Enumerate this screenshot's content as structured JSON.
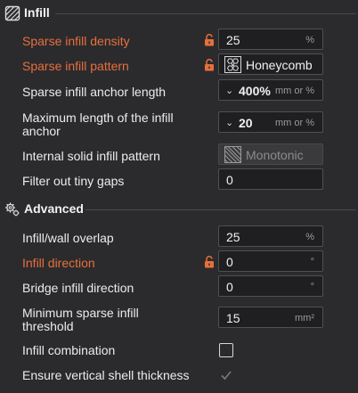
{
  "sections": {
    "infill": {
      "title": "Infill"
    },
    "advanced": {
      "title": "Advanced"
    }
  },
  "infill": {
    "sparse_density": {
      "label": "Sparse infill density",
      "value": "25",
      "unit": "%"
    },
    "sparse_pattern": {
      "label": "Sparse infill pattern",
      "value": "Honeycomb"
    },
    "anchor_length": {
      "label": "Sparse infill anchor length",
      "value": "400%",
      "unit": "mm or %"
    },
    "max_anchor": {
      "label_line1": "Maximum length of the infill",
      "label_line2": "anchor",
      "value": "20",
      "unit": "mm or %"
    },
    "internal_solid": {
      "label": "Internal solid infill pattern",
      "value": "Monotonic"
    },
    "filter_gaps": {
      "label": "Filter out tiny gaps",
      "value": "0"
    }
  },
  "advanced": {
    "overlap": {
      "label": "Infill/wall overlap",
      "value": "25",
      "unit": "%"
    },
    "direction": {
      "label": "Infill direction",
      "value": "0",
      "unit": "°"
    },
    "bridge_direction": {
      "label": "Bridge infill direction",
      "value": "0",
      "unit": "°"
    },
    "min_threshold": {
      "label_line1": "Minimum sparse infill",
      "label_line2": "threshold",
      "value": "15",
      "unit": "mm²"
    },
    "combination": {
      "label": "Infill combination",
      "checked": false
    },
    "vertical_shell": {
      "label": "Ensure vertical shell thickness",
      "checked": true
    }
  },
  "colors": {
    "modified": "#e86f3c",
    "background": "#2b2b2d"
  }
}
